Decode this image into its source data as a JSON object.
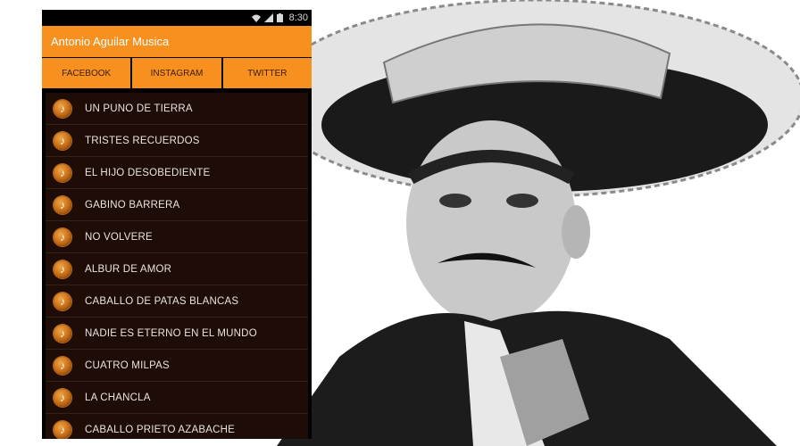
{
  "status": {
    "time": "8:30"
  },
  "app": {
    "title": "Antonio Aguilar Musica"
  },
  "social": [
    {
      "label": "FACEBOOK"
    },
    {
      "label": "INSTAGRAM"
    },
    {
      "label": "TWITTER"
    }
  ],
  "songs": [
    {
      "title": "UN PUNO DE TIERRA"
    },
    {
      "title": "TRISTES RECUERDOS"
    },
    {
      "title": "EL HIJO DESOBEDIENTE"
    },
    {
      "title": "GABINO BARRERA"
    },
    {
      "title": "NO VOLVERE"
    },
    {
      "title": "ALBUR DE AMOR"
    },
    {
      "title": "CABALLO DE PATAS BLANCAS"
    },
    {
      "title": "NADIE ES ETERNO EN EL MUNDO"
    },
    {
      "title": "CUATRO MILPAS"
    },
    {
      "title": "LA CHANCLA"
    },
    {
      "title": "CABALLO PRIETO AZABACHE"
    }
  ],
  "colors": {
    "accent": "#f7901e",
    "list_bg": "#1e0c07"
  }
}
